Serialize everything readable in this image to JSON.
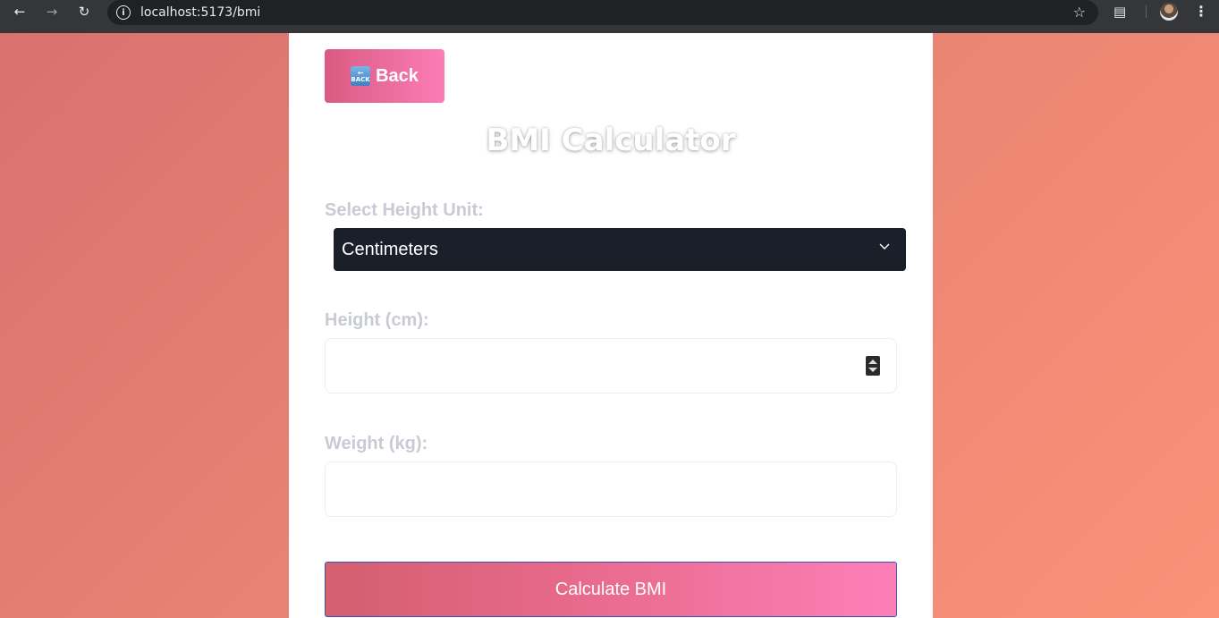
{
  "browser": {
    "url": "localhost:5173/bmi"
  },
  "page": {
    "back_label": "Back",
    "back_icon_text": "BACK",
    "title": "BMI Calculator",
    "height_unit_label": "Select Height Unit:",
    "height_unit_selected": "Centimeters",
    "height_label": "Height (cm):",
    "height_value": "",
    "weight_label": "Weight (kg):",
    "weight_value": "",
    "calculate_label": "Calculate BMI"
  },
  "colors": {
    "background_gradient_start": "#d9716f",
    "background_gradient_end": "#fa9277",
    "button_gradient_start": "#d95b82",
    "button_gradient_end": "#fb7db6",
    "select_background": "#1b1f2a",
    "label_color": "#c8cbd3"
  }
}
